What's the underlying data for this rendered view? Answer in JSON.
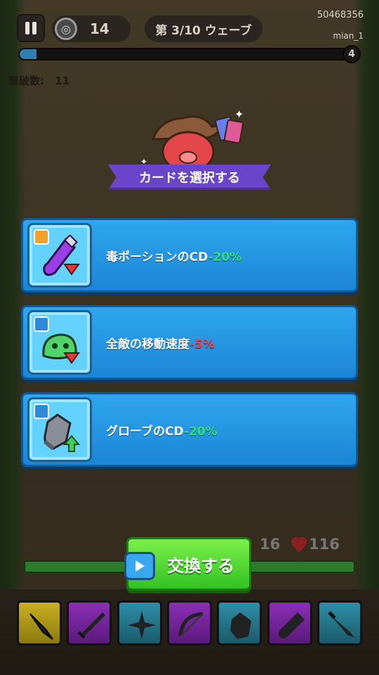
{
  "hud": {
    "coins": "14",
    "wave": "第 3/10 ウェーブ",
    "user_id": "50468356",
    "user_name": "mian_1",
    "wave_end_number": "4",
    "wave_progress_fraction": 0.05,
    "kills_label": "撃破数:",
    "kills_value": "11"
  },
  "title": "カードを選択する",
  "cards": [
    {
      "icon": "poison-potion-icon",
      "tag": "cooldown-clock-icon",
      "text": "毒ポーションのCD",
      "value": "-20%",
      "value_color": "#2fe07a"
    },
    {
      "icon": "green-slime-icon",
      "tag": "speed-arrow-icon",
      "text": "全敵の移動速度",
      "value": "-5%",
      "value_color": "#ff3b3b"
    },
    {
      "icon": "glove-icon",
      "tag": "boomerang-icon",
      "text": "グローブのCD",
      "value": "-20%",
      "value_color": "#2fe07a"
    }
  ],
  "exchange": {
    "label": "交換する",
    "icon": "video-ad-icon"
  },
  "player": {
    "shield": "16",
    "hp": "116"
  },
  "weapons": [
    {
      "name": "kunai-icon",
      "rarity_color": "#c9b020"
    },
    {
      "name": "sword-icon",
      "rarity_color": "#8b2fb6"
    },
    {
      "name": "shuriken-icon",
      "rarity_color": "#2f8fa8"
    },
    {
      "name": "bow-icon",
      "rarity_color": "#8b2fb6"
    },
    {
      "name": "glove-icon",
      "rarity_color": "#2f8fa8"
    },
    {
      "name": "potion-icon",
      "rarity_color": "#8b2fb6"
    },
    {
      "name": "dagger-icon",
      "rarity_color": "#2f8fa8"
    }
  ]
}
